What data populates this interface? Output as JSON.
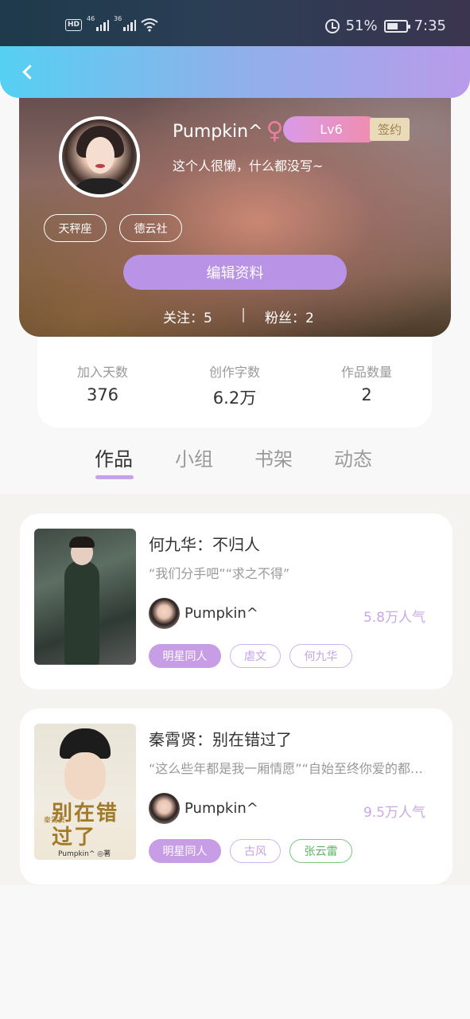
{
  "status_bar": {
    "hd": "HD",
    "net1": "46",
    "net2": "36",
    "battery": "51%",
    "time": "7:35"
  },
  "profile": {
    "name": "Pumpkin^",
    "gender_symbol": "♀",
    "level": "Lv6",
    "signed_badge": "签约",
    "bio": "这个人很懒，什么都没写~",
    "tags": [
      "天秤座",
      "德云社"
    ],
    "edit_button": "编辑资料",
    "following": "关注：5",
    "fans": "粉丝：2"
  },
  "stats": [
    {
      "label": "加入天数",
      "value": "376"
    },
    {
      "label": "创作字数",
      "value": "6.2万"
    },
    {
      "label": "作品数量",
      "value": "2"
    }
  ],
  "tabs": [
    "作品",
    "小组",
    "书架",
    "动态"
  ],
  "books": [
    {
      "title": "何九华：不归人",
      "desc": "“我们分手吧”“求之不得”",
      "author": "Pumpkin^",
      "popularity": "5.8万人气",
      "tags": [
        "明星同人",
        "虐文",
        "何九华"
      ]
    },
    {
      "title": "秦霄贤：别在错过了",
      "desc": "“这么些年都是我一厢情愿”“自始至终你爱的都是我”",
      "author": "Pumpkin^",
      "popularity": "9.5万人气",
      "tags": [
        "明星同人",
        "古风",
        "张云雷"
      ],
      "cover_title": "别在错过了",
      "cover_sub": "秦霄贤",
      "cover_author": "Pumpkin^ ◎著"
    }
  ],
  "colors": {
    "accent": "#b993e6",
    "topbar_start": "#55d0f2",
    "topbar_end": "#b89be9",
    "green_tag": "#5bb563"
  }
}
